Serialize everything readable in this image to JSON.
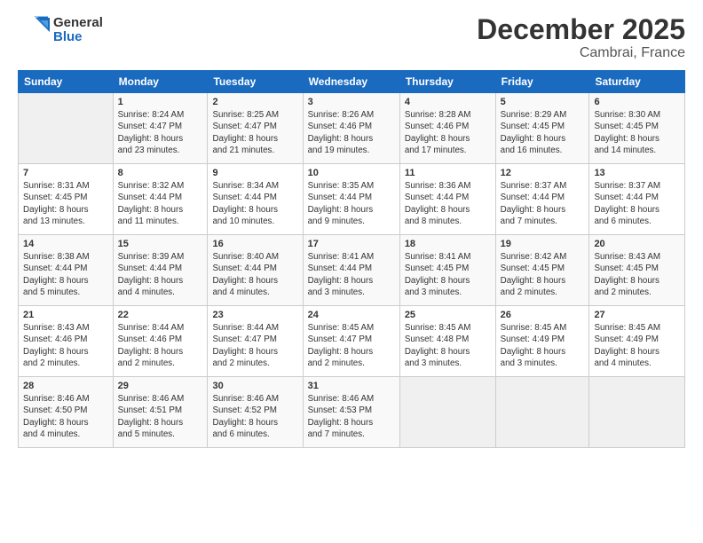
{
  "logo": {
    "general": "General",
    "blue": "Blue"
  },
  "title": "December 2025",
  "location": "Cambrai, France",
  "days_header": [
    "Sunday",
    "Monday",
    "Tuesday",
    "Wednesday",
    "Thursday",
    "Friday",
    "Saturday"
  ],
  "weeks": [
    [
      {
        "day": "",
        "info": ""
      },
      {
        "day": "1",
        "info": "Sunrise: 8:24 AM\nSunset: 4:47 PM\nDaylight: 8 hours\nand 23 minutes."
      },
      {
        "day": "2",
        "info": "Sunrise: 8:25 AM\nSunset: 4:47 PM\nDaylight: 8 hours\nand 21 minutes."
      },
      {
        "day": "3",
        "info": "Sunrise: 8:26 AM\nSunset: 4:46 PM\nDaylight: 8 hours\nand 19 minutes."
      },
      {
        "day": "4",
        "info": "Sunrise: 8:28 AM\nSunset: 4:46 PM\nDaylight: 8 hours\nand 17 minutes."
      },
      {
        "day": "5",
        "info": "Sunrise: 8:29 AM\nSunset: 4:45 PM\nDaylight: 8 hours\nand 16 minutes."
      },
      {
        "day": "6",
        "info": "Sunrise: 8:30 AM\nSunset: 4:45 PM\nDaylight: 8 hours\nand 14 minutes."
      }
    ],
    [
      {
        "day": "7",
        "info": "Sunrise: 8:31 AM\nSunset: 4:45 PM\nDaylight: 8 hours\nand 13 minutes."
      },
      {
        "day": "8",
        "info": "Sunrise: 8:32 AM\nSunset: 4:44 PM\nDaylight: 8 hours\nand 11 minutes."
      },
      {
        "day": "9",
        "info": "Sunrise: 8:34 AM\nSunset: 4:44 PM\nDaylight: 8 hours\nand 10 minutes."
      },
      {
        "day": "10",
        "info": "Sunrise: 8:35 AM\nSunset: 4:44 PM\nDaylight: 8 hours\nand 9 minutes."
      },
      {
        "day": "11",
        "info": "Sunrise: 8:36 AM\nSunset: 4:44 PM\nDaylight: 8 hours\nand 8 minutes."
      },
      {
        "day": "12",
        "info": "Sunrise: 8:37 AM\nSunset: 4:44 PM\nDaylight: 8 hours\nand 7 minutes."
      },
      {
        "day": "13",
        "info": "Sunrise: 8:37 AM\nSunset: 4:44 PM\nDaylight: 8 hours\nand 6 minutes."
      }
    ],
    [
      {
        "day": "14",
        "info": "Sunrise: 8:38 AM\nSunset: 4:44 PM\nDaylight: 8 hours\nand 5 minutes."
      },
      {
        "day": "15",
        "info": "Sunrise: 8:39 AM\nSunset: 4:44 PM\nDaylight: 8 hours\nand 4 minutes."
      },
      {
        "day": "16",
        "info": "Sunrise: 8:40 AM\nSunset: 4:44 PM\nDaylight: 8 hours\nand 4 minutes."
      },
      {
        "day": "17",
        "info": "Sunrise: 8:41 AM\nSunset: 4:44 PM\nDaylight: 8 hours\nand 3 minutes."
      },
      {
        "day": "18",
        "info": "Sunrise: 8:41 AM\nSunset: 4:45 PM\nDaylight: 8 hours\nand 3 minutes."
      },
      {
        "day": "19",
        "info": "Sunrise: 8:42 AM\nSunset: 4:45 PM\nDaylight: 8 hours\nand 2 minutes."
      },
      {
        "day": "20",
        "info": "Sunrise: 8:43 AM\nSunset: 4:45 PM\nDaylight: 8 hours\nand 2 minutes."
      }
    ],
    [
      {
        "day": "21",
        "info": "Sunrise: 8:43 AM\nSunset: 4:46 PM\nDaylight: 8 hours\nand 2 minutes."
      },
      {
        "day": "22",
        "info": "Sunrise: 8:44 AM\nSunset: 4:46 PM\nDaylight: 8 hours\nand 2 minutes."
      },
      {
        "day": "23",
        "info": "Sunrise: 8:44 AM\nSunset: 4:47 PM\nDaylight: 8 hours\nand 2 minutes."
      },
      {
        "day": "24",
        "info": "Sunrise: 8:45 AM\nSunset: 4:47 PM\nDaylight: 8 hours\nand 2 minutes."
      },
      {
        "day": "25",
        "info": "Sunrise: 8:45 AM\nSunset: 4:48 PM\nDaylight: 8 hours\nand 3 minutes."
      },
      {
        "day": "26",
        "info": "Sunrise: 8:45 AM\nSunset: 4:49 PM\nDaylight: 8 hours\nand 3 minutes."
      },
      {
        "day": "27",
        "info": "Sunrise: 8:45 AM\nSunset: 4:49 PM\nDaylight: 8 hours\nand 4 minutes."
      }
    ],
    [
      {
        "day": "28",
        "info": "Sunrise: 8:46 AM\nSunset: 4:50 PM\nDaylight: 8 hours\nand 4 minutes."
      },
      {
        "day": "29",
        "info": "Sunrise: 8:46 AM\nSunset: 4:51 PM\nDaylight: 8 hours\nand 5 minutes."
      },
      {
        "day": "30",
        "info": "Sunrise: 8:46 AM\nSunset: 4:52 PM\nDaylight: 8 hours\nand 6 minutes."
      },
      {
        "day": "31",
        "info": "Sunrise: 8:46 AM\nSunset: 4:53 PM\nDaylight: 8 hours\nand 7 minutes."
      },
      {
        "day": "",
        "info": ""
      },
      {
        "day": "",
        "info": ""
      },
      {
        "day": "",
        "info": ""
      }
    ]
  ]
}
